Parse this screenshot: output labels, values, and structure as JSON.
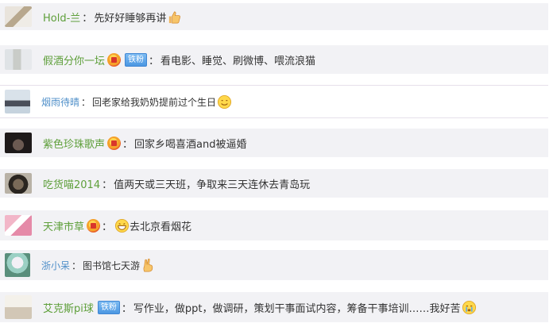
{
  "comments": [
    {
      "name": "Hold-兰",
      "colon": "：",
      "text": "先好好睡够再讲",
      "emoji": "thumbs-up-icon"
    },
    {
      "name": "假酒分你一坛",
      "colon": "：",
      "badge": "铁粉",
      "text": "看电影、睡觉、刷微博、喂流浪猫"
    },
    {
      "name": "烟雨待晴",
      "colon": "：",
      "text": "回老家给我奶奶提前过个生日",
      "emoji": "smile-face-icon"
    },
    {
      "name": "紫色珍珠歌声",
      "colon": "：",
      "text": "回家乡喝喜酒and被逼婚"
    },
    {
      "name": "吃货喵2014",
      "colon": "：",
      "text": "值两天或三天班，争取来三天连休去青岛玩"
    },
    {
      "name": "天津市草",
      "colon": "：",
      "text": "去北京看烟花",
      "emoji": "grin-face-icon"
    },
    {
      "name": "浙小呆",
      "colon": "：",
      "text": "图书馆七天游",
      "emoji": "yeah-hand-icon"
    },
    {
      "name": "艾克斯pi球",
      "colon": "：",
      "badge": "铁粉",
      "text": "写作业，做ppt，做调研，策划干事面试内容，筹备干事培训……我好苦",
      "emoji": "crying-face-icon"
    }
  ],
  "colors": {
    "username_green": "#5e9f3a",
    "username_blue": "#4f8fc9",
    "row_bg": "#f2f2f5",
    "text": "#333333"
  }
}
